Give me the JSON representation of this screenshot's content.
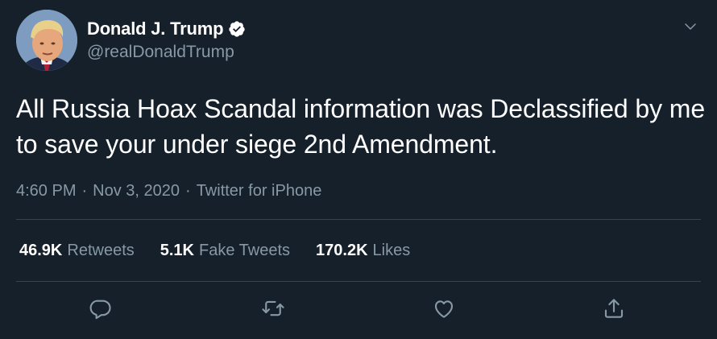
{
  "user": {
    "display_name": "Donald J. Trump",
    "handle": "@realDonaldTrump",
    "verified": true
  },
  "tweet": {
    "text": "All Russia Hoax Scandal information was Declassified by me to save your under siege 2nd Amendment."
  },
  "meta": {
    "time": "4:60 PM",
    "sep1": "·",
    "date": "Nov 3, 2020",
    "sep2": "·",
    "source": "Twitter for iPhone"
  },
  "stats": [
    {
      "count": "46.9K",
      "label": "Retweets"
    },
    {
      "count": "5.1K",
      "label": "Fake Tweets"
    },
    {
      "count": "170.2K",
      "label": "Likes"
    }
  ],
  "icons": {
    "menu": "chevron-down-icon",
    "reply": "reply-icon",
    "retweet": "retweet-icon",
    "like": "heart-icon",
    "share": "share-icon"
  },
  "colors": {
    "background": "#15202b",
    "text": "#ffffff",
    "secondary_text": "#8899a6",
    "divider": "#38444d",
    "verified_badge": "#ffffff"
  }
}
